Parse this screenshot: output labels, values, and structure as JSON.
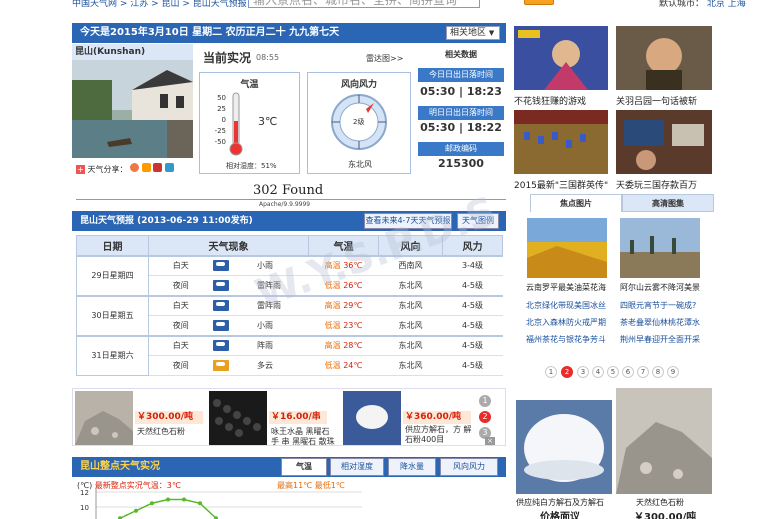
{
  "top": {
    "breadcrumb": "中国天气网 > 江苏 > 昆山 > 昆山天气预报",
    "search_placeholder": "输入景点名、城市名、全拼、简拼查询",
    "search_button": "查询",
    "default_city_label": "默认城市：",
    "default_city": "北京",
    "shanghai": "上海"
  },
  "date_bar": {
    "text": "今天是2015年3月10日 星期二 农历正月二十 九九第七天",
    "region_button": "相关地区"
  },
  "city": {
    "name": "昆山(Kunshan)",
    "share_label": "天气分享："
  },
  "current": {
    "title": "当前实况",
    "time": "08:55",
    "radar_link": "雷达图>>",
    "temp_header": "气温",
    "temp_value": "3℃",
    "scale": [
      "50",
      "25",
      "0",
      "-25",
      "-50"
    ],
    "humidity": "相对湿度：51%",
    "wind_header": "风向风力",
    "wind_level": "2级",
    "wind_dir": "东北风"
  },
  "related": {
    "header": "相关数据",
    "today_label": "今日日出日落时间",
    "today_value": "05:30 | 18:23",
    "tomorrow_label": "明日日出日落时间",
    "tomorrow_value": "05:30 | 18:22",
    "postcode_label": "邮政编码",
    "postcode_value": "215300"
  },
  "error": {
    "title": "302 Found",
    "server": "Apache/9.9.9999"
  },
  "forecast": {
    "title": "昆山天气预报 (2013-06-29 11:00发布)",
    "btn_more": "查看未来4-7天天气预报",
    "btn_map": "天气图例",
    "headers": [
      "日期",
      "天气现象",
      "气温",
      "风向",
      "风力"
    ],
    "days": [
      {
        "date": "29日星期四",
        "rows": [
          {
            "period": "白天",
            "weather": "小雨",
            "temp_label": "高温",
            "temp": "36℃",
            "wind": "西南风",
            "force": "3-4级"
          },
          {
            "period": "夜间",
            "weather": "雷阵雨",
            "temp_label": "低温",
            "temp": "26℃",
            "wind": "东北风",
            "force": "4-5级"
          }
        ]
      },
      {
        "date": "30日星期五",
        "rows": [
          {
            "period": "白天",
            "weather": "雷阵雨",
            "temp_label": "高温",
            "temp": "29℃",
            "wind": "东北风",
            "force": "4-5级"
          },
          {
            "period": "夜间",
            "weather": "小雨",
            "temp_label": "低温",
            "temp": "23℃",
            "wind": "东北风",
            "force": "4-5级"
          }
        ]
      },
      {
        "date": "31日星期六",
        "rows": [
          {
            "period": "白天",
            "weather": "阵雨",
            "temp_label": "高温",
            "temp": "28℃",
            "wind": "东北风",
            "force": "4-5级"
          },
          {
            "period": "夜间",
            "weather": "多云",
            "temp_label": "低温",
            "temp": "24℃",
            "wind": "东北风",
            "force": "4-5级"
          }
        ]
      }
    ]
  },
  "products": [
    {
      "price": "￥300.00/吨",
      "desc": "天然红色石粉"
    },
    {
      "price": "￥16.00/串",
      "desc": "咏王水晶 黑曜石手 串 黑曜石 散珠"
    },
    {
      "price": "￥360.00/吨",
      "desc": "供应方解石，方 解石粉400目"
    }
  ],
  "product_nav": [
    "1",
    "2",
    "3"
  ],
  "hourly": {
    "title": "昆山整点天气实况",
    "tabs": [
      "气温",
      "相对湿度",
      "降水量",
      "风向风力"
    ],
    "sub_left": "最新整点实况气温：3℃",
    "sub_right": "最高11℃ 最低1℃",
    "unit": "(℃)",
    "y_ticks": [
      "12",
      "10"
    ]
  },
  "chart_data": {
    "type": "line",
    "title": "",
    "ylabel": "(℃)",
    "ylim": [
      8,
      12
    ],
    "x": [
      1,
      2,
      3,
      4,
      5,
      6,
      7
    ],
    "values": [
      8.5,
      9.5,
      10.5,
      11,
      11,
      10.5,
      8.5
    ]
  },
  "right": {
    "news": [
      {
        "caption": "不花钱狂赚的游戏"
      },
      {
        "caption": "关羽吕园一句话被斩"
      },
      {
        "caption": "2015最新\"三国群英传\""
      },
      {
        "caption": "天委玩三国存款百万"
      }
    ],
    "tabs": [
      "焦点图片",
      "高清图集"
    ],
    "pics": [
      {
        "caption": "云南罗平最美油菜花海"
      },
      {
        "caption": "阿尔山云雾不降河美景"
      }
    ],
    "links": [
      [
        "北京绿化带现美国冰丝",
        "四眼元宵节于一碗成?"
      ],
      [
        "北京入森林防火戒严期",
        "茶老叠翠仙林桃花潭水"
      ],
      [
        "福州茶花与银花争芳斗",
        "荆州早春迎开全面开采"
      ]
    ],
    "pages": [
      "1",
      "2",
      "3",
      "4",
      "5",
      "6",
      "7",
      "8",
      "9"
    ],
    "ads": [
      {
        "caption": "供应纯白方解石及方解石",
        "price": "价格面议"
      },
      {
        "caption": "天然红色石粉",
        "price": "￥300.00/吨"
      }
    ]
  },
  "watermark": "W.Y.S.P.D.S"
}
